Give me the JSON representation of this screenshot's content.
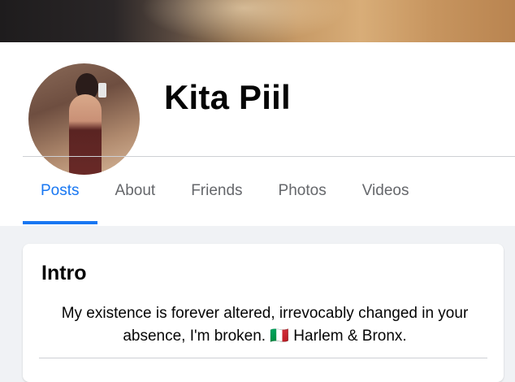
{
  "profile": {
    "name": "Kita Piil"
  },
  "tabs": [
    {
      "label": "Posts",
      "active": true
    },
    {
      "label": "About"
    },
    {
      "label": "Friends"
    },
    {
      "label": "Photos"
    },
    {
      "label": "Videos"
    }
  ],
  "intro": {
    "title": "Intro",
    "bio": "My existence is forever altered, irrevocably changed in your absence, I'm broken. 🇮🇹 Harlem & Bronx."
  },
  "colors": {
    "accent": "#1877f2",
    "page_background": "#f0f2f5",
    "tab_inactive": "#65676b"
  }
}
